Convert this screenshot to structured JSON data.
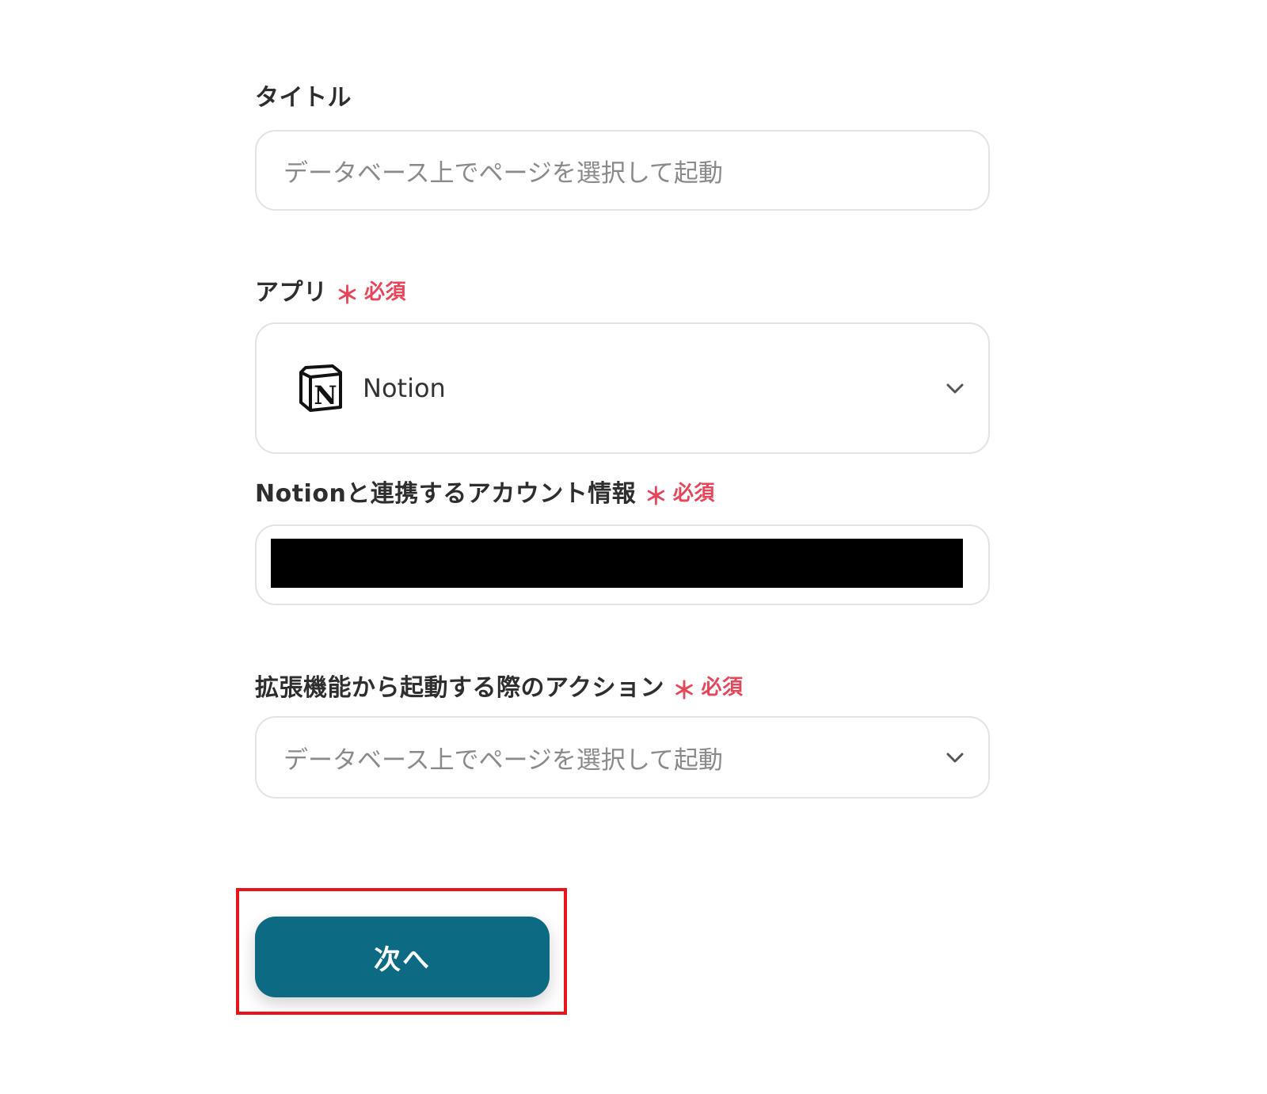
{
  "form": {
    "title_field": {
      "label": "タイトル",
      "value": "データベース上でページを選択して起動"
    },
    "app_field": {
      "label": "アプリ",
      "required_mark": "＊",
      "required_text": "必須",
      "selected_app": "Notion",
      "icon": "notion-logo"
    },
    "account_field": {
      "label": "Notionと連携するアカウント情報",
      "required_mark": "＊",
      "required_text": "必須"
    },
    "action_field": {
      "label": "拡張機能から起動する際のアクション",
      "required_mark": "＊",
      "required_text": "必須",
      "value": "データベース上でページを選択して起動"
    }
  },
  "next_button": {
    "label": "次へ"
  },
  "colors": {
    "primary": "#0d6a83",
    "required": "#e8455a",
    "highlight": "#e8141c"
  }
}
